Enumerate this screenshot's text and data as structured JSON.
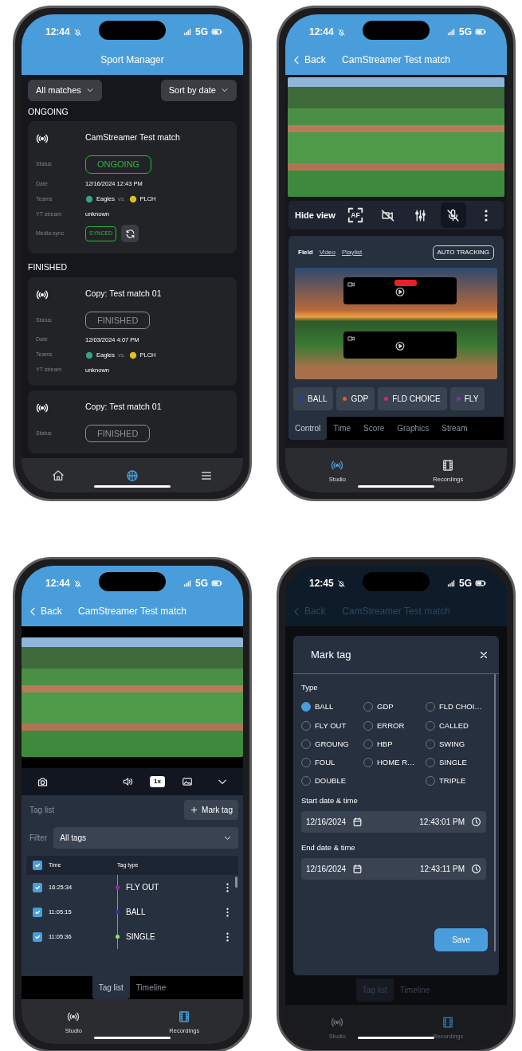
{
  "phones": [
    {
      "kind": "matches",
      "dimmed": false,
      "status_bar": {
        "time": "12:44",
        "network": "5G"
      },
      "header": {
        "title": "Sport Manager"
      },
      "filters": [
        "All matches",
        "Sort by date"
      ],
      "sections": [
        {
          "title": "ONGOING",
          "matches": [
            {
              "title": "CamStreamer Test match",
              "rows": [
                {
                  "kind": "status",
                  "label": "Status",
                  "value": "ONGOING",
                  "active": true
                },
                {
                  "kind": "text",
                  "label": "Date",
                  "value": "12/16/2024 12:43 PM"
                },
                {
                  "kind": "teams",
                  "label": "Teams",
                  "home": "Eagles",
                  "vs": "vs.",
                  "away": "PLCH"
                },
                {
                  "kind": "text",
                  "label": "YT stream",
                  "value": "unknown"
                },
                {
                  "kind": "sync",
                  "label": "Media sync",
                  "value": "SYNCED"
                }
              ]
            }
          ]
        },
        {
          "title": "FINISHED",
          "matches": [
            {
              "title": "Copy: Test match 01",
              "rows": [
                {
                  "kind": "status",
                  "label": "Status",
                  "value": "FINISHED",
                  "active": false
                },
                {
                  "kind": "text",
                  "label": "Date",
                  "value": "12/03/2024 4:07 PM"
                },
                {
                  "kind": "teams",
                  "label": "Teams",
                  "home": "Eagles",
                  "vs": "vs.",
                  "away": "PLCH"
                },
                {
                  "kind": "text",
                  "label": "YT stream",
                  "value": "unknown"
                }
              ]
            },
            {
              "title": "Copy: Test match 01",
              "rows": [
                {
                  "kind": "status",
                  "label": "Status",
                  "value": "FINISHED",
                  "active": false
                }
              ]
            }
          ]
        }
      ],
      "nav": [
        {
          "kind": "home",
          "selected": false
        },
        {
          "kind": "ball",
          "selected": true
        },
        {
          "kind": "menu",
          "selected": false
        }
      ]
    },
    {
      "kind": "studio",
      "dimmed": false,
      "status_bar": {
        "time": "12:44",
        "network": "5G"
      },
      "header": {
        "back": "Back",
        "title": "CamStreamer Test match"
      },
      "toolbar": {
        "label": "Hide view",
        "buttons": [
          {
            "kind": "autofocus",
            "text": "AF",
            "selected": false
          },
          {
            "kind": "video-off",
            "selected": false
          },
          {
            "kind": "mixer",
            "selected": false
          },
          {
            "kind": "mic-off",
            "selected": true
          },
          {
            "kind": "more",
            "selected": false
          }
        ]
      },
      "view_tabs": [
        {
          "label": "Field",
          "selected": true
        },
        {
          "label": "Video",
          "selected": false
        },
        {
          "label": "Playlist",
          "selected": false
        }
      ],
      "auto_tracking": "AUTO TRACKING",
      "cameras": [
        {
          "live": true
        },
        {
          "live": false
        }
      ],
      "tags": [
        {
          "label": "BALL",
          "color": "#1d3fa8"
        },
        {
          "label": "GDP",
          "color": "#e85a24"
        },
        {
          "label": "FLD CHOICE",
          "color": "#e21e7d"
        },
        {
          "label": "FLY",
          "color": "#8a2cb4"
        }
      ],
      "tabs": [
        {
          "label": "Control",
          "selected": true
        },
        {
          "label": "Time",
          "selected": false
        },
        {
          "label": "Score",
          "selected": false
        },
        {
          "label": "Graphics",
          "selected": false
        },
        {
          "label": "Stream",
          "selected": false
        }
      ],
      "nav": [
        {
          "kind": "studio",
          "label": "Studio",
          "selected": true
        },
        {
          "kind": "recordings",
          "label": "Recordings",
          "selected": false
        }
      ]
    },
    {
      "kind": "recordings",
      "dimmed": false,
      "status_bar": {
        "time": "12:44",
        "network": "5G"
      },
      "header": {
        "back": "Back",
        "title": "CamStreamer Test match"
      },
      "player": {
        "speed": "1x"
      },
      "tag_list": {
        "title": "Tag list",
        "add": "Mark tag",
        "filter_label": "Filter",
        "filter": "All tags",
        "columns": [
          "Time",
          "Tag type"
        ],
        "all_checked": true,
        "rows": [
          {
            "checked": true,
            "time": "16:25:34",
            "type": "FLY OUT",
            "color": "#8a2cb4"
          },
          {
            "checked": true,
            "time": "11:05:15",
            "type": "BALL",
            "color": "#1d3fa8"
          },
          {
            "checked": true,
            "time": "11:05:36",
            "type": "SINGLE",
            "color": "#8ee86a"
          }
        ]
      },
      "tabs": [
        {
          "label": "Tag list",
          "selected": true
        },
        {
          "label": "Timeline",
          "selected": false
        }
      ],
      "nav": [
        {
          "kind": "studio",
          "label": "Studio",
          "selected": false
        },
        {
          "kind": "recordings",
          "label": "Recordings",
          "selected": true
        }
      ]
    },
    {
      "kind": "mark_tag",
      "dimmed": true,
      "status_bar": {
        "time": "12:45",
        "network": "5G"
      },
      "header": {
        "back": "Back",
        "title": "CamStreamer Test match"
      },
      "dialog": {
        "title": "Mark tag",
        "type_label": "Type",
        "option_columns": [
          [
            {
              "label": "BALL",
              "selected": true
            },
            {
              "label": "FLY OUT",
              "selected": false
            },
            {
              "label": "GROUNG",
              "selected": false
            },
            {
              "label": "FOUL",
              "selected": false
            },
            {
              "label": "DOUBLE",
              "selected": false
            }
          ],
          [
            {
              "label": "GDP",
              "selected": false
            },
            {
              "label": "ERROR",
              "selected": false
            },
            {
              "label": "HBP",
              "selected": false
            },
            {
              "label": "HOME R…",
              "selected": false
            }
          ],
          [
            {
              "label": "FLD CHOI…",
              "selected": false
            },
            {
              "label": "CALLED",
              "selected": false
            },
            {
              "label": "SWING",
              "selected": false
            },
            {
              "label": "SINGLE",
              "selected": false
            },
            {
              "label": "TRIPLE",
              "selected": false
            }
          ]
        ],
        "start_label": "Start date & time",
        "start_date": "12/16/2024",
        "start_time": "12:43:01 PM",
        "end_label": "End date & time",
        "end_date": "12/16/2024",
        "end_time": "12:43:11 PM",
        "save": "Save"
      },
      "tabs": [
        {
          "label": "Tag list",
          "selected": true
        },
        {
          "label": "Timeline",
          "selected": false
        }
      ],
      "nav": [
        {
          "kind": "studio",
          "label": "Studio",
          "selected": false
        },
        {
          "kind": "recordings",
          "label": "Recordings",
          "selected": true
        }
      ]
    }
  ]
}
